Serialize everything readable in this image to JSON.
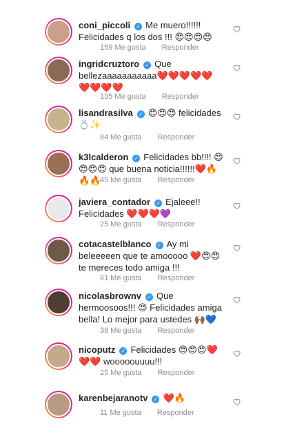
{
  "comments": [
    {
      "username": "coni_piccoli",
      "text": "Me muero!!!!!! Felicidades q los dos !!! 😍😍😍😍",
      "likes": "159 Me gusta",
      "reply": "Responder",
      "avatar_color": "#c9a08a"
    },
    {
      "username": "ingridcruztoro",
      "text": "Que bellezaaaaaaaaaaa❤️❤️❤️❤️❤️❤️❤️❤️❤️",
      "likes": "135 Me gusta",
      "reply": "Responder",
      "avatar_color": "#8a6a55"
    },
    {
      "username": "lisandrasilva",
      "text": "😍😍😍 felicidades 💍✨",
      "likes": "84 Me gusta",
      "reply": "Responder",
      "avatar_color": "#c7b48c"
    },
    {
      "username": "k3lcalderon",
      "text": "Felicidades bb!!!! 😍😍😍😍 que buena noticia!!!!!!❤️🔥🔥🔥",
      "likes": "45 Me gusta",
      "reply": "Responder",
      "avatar_color": "#9b6e58"
    },
    {
      "username": "javiera_contador",
      "text": "Ejaleee!! Felicidades ❤️❤️❤️💜",
      "likes": "25 Me gusta",
      "reply": "Responder",
      "avatar_color": "#e9e9e9"
    },
    {
      "username": "cotacastelblanco",
      "text": "Ay mi beleeeeen que te amooooo ❤️😍😍 te mereces todo amiga !!!",
      "likes": "61 Me gusta",
      "reply": "Responder",
      "avatar_color": "#6f5a4a"
    },
    {
      "username": "nicolasbrownv",
      "text": "Que hermoosoos!!! 😍 Felicidades amiga bella! Lo mejor para ustedes 🙌🏾💙",
      "likes": "38 Me gusta",
      "reply": "Responder",
      "avatar_color": "#4e3e33"
    },
    {
      "username": "nicoputz",
      "text": "Felicidades 😍😍😍❤️❤️❤️ wooooouuuu!!!",
      "likes": "25 Me gusta",
      "reply": "Responder",
      "avatar_color": "#c4a98a"
    },
    {
      "username": "karenbejaranotv",
      "text": "❤️🔥",
      "likes": "11 Me gusta",
      "reply": "Responder",
      "avatar_color": "#b89a86"
    }
  ],
  "colors": {
    "verified": "#3897f0",
    "meta_text": "#8e8e8e",
    "text": "#262626"
  }
}
